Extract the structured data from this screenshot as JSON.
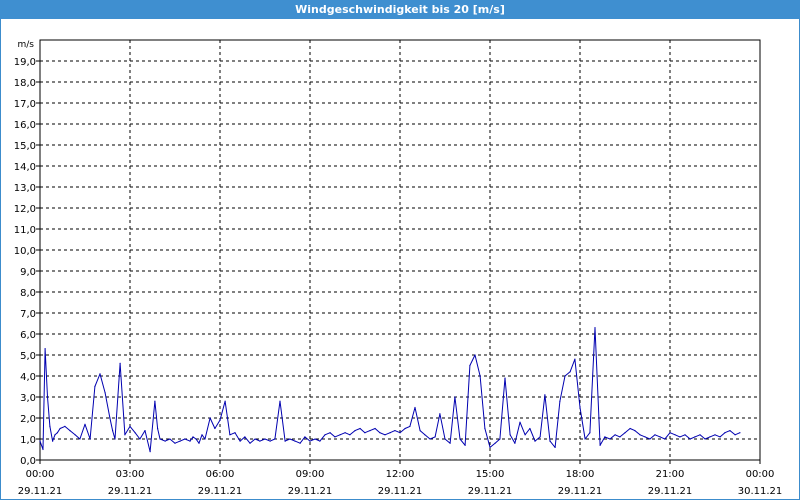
{
  "window": {
    "title": "Windgeschwindigkeit bis 20 [m/s]"
  },
  "colors": {
    "title_bar": "#3f8fd0",
    "series_line": "#0000b0",
    "grid": "#000000"
  },
  "chart_data": {
    "type": "line",
    "title": "Windgeschwindigkeit bis 20 [m/s]",
    "ylabel": "m/s",
    "xlabel": "",
    "ylim": [
      0,
      20
    ],
    "xlim_hours": [
      0,
      24
    ],
    "grid": true,
    "y_ticks": [
      "0,0",
      "1,0",
      "2,0",
      "3,0",
      "4,0",
      "5,0",
      "6,0",
      "7,0",
      "8,0",
      "9,0",
      "10,0",
      "11,0",
      "12,0",
      "13,0",
      "14,0",
      "15,0",
      "16,0",
      "17,0",
      "18,0",
      "19,0"
    ],
    "x_ticks": [
      {
        "time": "00:00",
        "date": "29.11.21"
      },
      {
        "time": "03:00",
        "date": "29.11.21"
      },
      {
        "time": "06:00",
        "date": "29.11.21"
      },
      {
        "time": "09:00",
        "date": "29.11.21"
      },
      {
        "time": "12:00",
        "date": "29.11.21"
      },
      {
        "time": "15:00",
        "date": "29.11.21"
      },
      {
        "time": "18:00",
        "date": "29.11.21"
      },
      {
        "time": "21:00",
        "date": "29.11.21"
      },
      {
        "time": "00:00",
        "date": "30.11.21"
      }
    ],
    "series": [
      {
        "x_hours": [
          0.0,
          0.1,
          0.17,
          0.25,
          0.33,
          0.42,
          0.5,
          0.58,
          0.67,
          0.83,
          1.0,
          1.17,
          1.33,
          1.5,
          1.67,
          1.83,
          2.0,
          2.17,
          2.33,
          2.42,
          2.5,
          2.67,
          2.83,
          3.0,
          3.17,
          3.33,
          3.5,
          3.67,
          3.83,
          3.92,
          4.0,
          4.17,
          4.33,
          4.5,
          4.67,
          4.83,
          5.0,
          5.1,
          5.2,
          5.3,
          5.4,
          5.5,
          5.67,
          5.83,
          6.0,
          6.17,
          6.33,
          6.5,
          6.67,
          6.83,
          7.0,
          7.17,
          7.33,
          7.5,
          7.67,
          7.83,
          8.0,
          8.17,
          8.33,
          8.5,
          8.67,
          8.83,
          9.0,
          9.17,
          9.33,
          9.5,
          9.67,
          9.83,
          10.0,
          10.17,
          10.33,
          10.5,
          10.67,
          10.83,
          11.0,
          11.17,
          11.33,
          11.5,
          11.67,
          11.83,
          12.0,
          12.17,
          12.33,
          12.5,
          12.67,
          12.83,
          13.0,
          13.17,
          13.33,
          13.5,
          13.67,
          13.83,
          14.0,
          14.17,
          14.33,
          14.5,
          14.67,
          14.83,
          15.0,
          15.17,
          15.33,
          15.5,
          15.67,
          15.83,
          16.0,
          16.17,
          16.33,
          16.5,
          16.67,
          16.83,
          17.0,
          17.17,
          17.33,
          17.5,
          17.67,
          17.83,
          18.0,
          18.17,
          18.33,
          18.5,
          18.67,
          18.83,
          19.0,
          19.17,
          19.33,
          19.5,
          19.67,
          19.83,
          20.0,
          20.17,
          20.33,
          20.5,
          20.67,
          20.83,
          21.0,
          21.17,
          21.33,
          21.5,
          21.67,
          21.83,
          22.0,
          22.17,
          22.33,
          22.5,
          22.67,
          22.83,
          23.0,
          23.17,
          23.33,
          23.5,
          23.67,
          23.83,
          24.0
        ],
        "values": [
          0.9,
          0.5,
          5.3,
          3.0,
          1.6,
          0.9,
          1.2,
          1.3,
          1.5,
          1.6,
          1.4,
          1.2,
          1.0,
          1.7,
          1.0,
          3.5,
          4.1,
          3.2,
          2.0,
          1.4,
          1.0,
          4.6,
          1.2,
          1.6,
          1.3,
          1.0,
          1.4,
          0.4,
          2.8,
          1.5,
          1.0,
          0.9,
          1.0,
          0.8,
          0.9,
          1.0,
          0.9,
          1.1,
          1.0,
          0.8,
          1.2,
          1.0,
          2.0,
          1.5,
          1.9,
          2.8,
          1.2,
          1.3,
          0.9,
          1.1,
          0.8,
          1.0,
          0.9,
          1.0,
          0.9,
          1.0,
          2.8,
          0.9,
          1.0,
          0.9,
          0.8,
          1.1,
          0.9,
          1.0,
          0.9,
          1.2,
          1.3,
          1.1,
          1.2,
          1.3,
          1.2,
          1.4,
          1.5,
          1.3,
          1.4,
          1.5,
          1.3,
          1.2,
          1.3,
          1.4,
          1.3,
          1.5,
          1.6,
          2.5,
          1.4,
          1.2,
          1.0,
          1.1,
          2.2,
          1.0,
          0.8,
          3.0,
          1.0,
          0.7,
          4.5,
          5.0,
          4.0,
          1.5,
          0.6,
          0.8,
          1.0,
          3.9,
          1.2,
          0.8,
          1.8,
          1.2,
          1.5,
          0.9,
          1.1,
          3.1,
          0.9,
          0.6,
          2.8,
          4.0,
          4.2,
          4.8,
          2.5,
          1.0,
          1.3,
          6.3,
          0.7,
          1.1,
          1.0,
          1.2,
          1.1,
          1.3,
          1.5,
          1.4,
          1.2,
          1.1,
          1.0,
          1.2,
          1.1,
          1.0,
          1.3,
          1.2,
          1.1,
          1.2,
          1.0,
          1.1,
          1.2,
          1.0,
          1.1,
          1.2,
          1.1,
          1.3,
          1.4,
          1.2,
          1.3
        ]
      }
    ]
  }
}
